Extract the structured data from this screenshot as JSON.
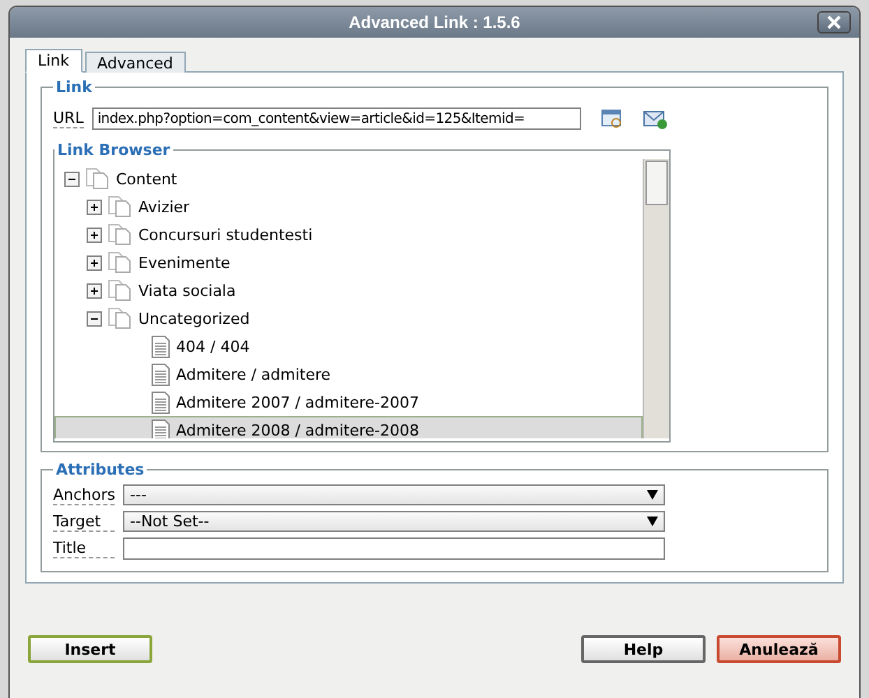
{
  "window": {
    "title": "Advanced Link : 1.5.6"
  },
  "tabs": [
    {
      "label": "Link",
      "selected": true
    },
    {
      "label": "Advanced",
      "selected": false
    }
  ],
  "link": {
    "legend": "Link",
    "url_label": "URL",
    "url_value": "index.php?option=com_content&view=article&id=125&Itemid="
  },
  "link_browser": {
    "legend": "Link Browser",
    "tree": [
      {
        "kind": "folder",
        "label": "Content",
        "expanded": true,
        "selected": false,
        "children": [
          {
            "kind": "folder",
            "label": "Avizier",
            "expanded": false,
            "selected": false
          },
          {
            "kind": "folder",
            "label": "Concursuri studentesti",
            "expanded": false,
            "selected": false
          },
          {
            "kind": "folder",
            "label": "Evenimente",
            "expanded": false,
            "selected": false
          },
          {
            "kind": "folder",
            "label": "Viata sociala",
            "expanded": false,
            "selected": false
          },
          {
            "kind": "folder",
            "label": "Uncategorized",
            "expanded": true,
            "selected": false,
            "children": [
              {
                "kind": "article",
                "label": "404 / 404",
                "selected": false
              },
              {
                "kind": "article",
                "label": "Admitere / admitere",
                "selected": false
              },
              {
                "kind": "article",
                "label": "Admitere 2007 / admitere-2007",
                "selected": false
              },
              {
                "kind": "article",
                "label": "Admitere 2008 / admitere-2008",
                "selected": true
              }
            ]
          }
        ]
      }
    ]
  },
  "attributes": {
    "legend": "Attributes",
    "anchors_label": "Anchors",
    "anchors_value": "---",
    "target_label": "Target",
    "target_value": "--Not Set--",
    "title_label": "Title"
  },
  "buttons": [
    {
      "label": "Insert",
      "kind": "insert"
    },
    {
      "label": "Help",
      "kind": "help"
    },
    {
      "label": "Anulează",
      "kind": "cancel"
    }
  ]
}
